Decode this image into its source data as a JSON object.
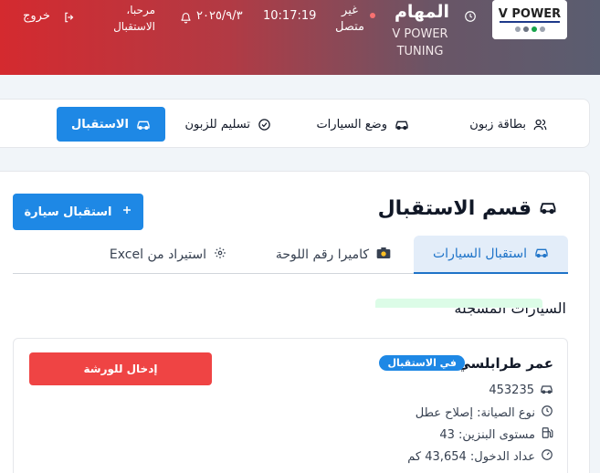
{
  "header": {
    "logo_text": "V POWER",
    "title": "المهام",
    "company": "V POWER TUNING",
    "connection_status": "غير متصل",
    "time": "10:17:19",
    "date": "٢٠٢٥/٩/٣",
    "welcome": "مرحبا، الاستقبال",
    "logout": "خروج"
  },
  "nav": {
    "items": [
      {
        "label": "بطاقة زبون",
        "icon": "users-icon"
      },
      {
        "label": "وضع السيارات",
        "icon": "car-icon"
      },
      {
        "label": "تسليم للزبون",
        "icon": "check-circle-icon"
      },
      {
        "label": "الاستقبال",
        "icon": "car-icon",
        "active": true
      }
    ]
  },
  "reception": {
    "title": "قسم الاستقبال",
    "add_button": "استقبال سيارة",
    "tabs": [
      {
        "label": "استقبال السيارات",
        "icon": "car-icon",
        "active": true
      },
      {
        "label": "كاميرا رقم اللوحة",
        "icon": "camera-icon"
      },
      {
        "label": "استيراد من Excel",
        "icon": "gear-icon"
      }
    ],
    "registered_title": "السيارات المسجلة"
  },
  "car": {
    "owner": "عمر طرابلسي",
    "status_badge": "في الاستقبال",
    "plate": "453235",
    "maintenance": "نوع الصيانة: إصلاح عطل",
    "fuel": "مستوى البنزين: 43",
    "odometer": "عداد الدخول: 43,654 كم",
    "enter_button": "إدخال للورشة"
  },
  "colors": {
    "header_start": "#d42a2f",
    "header_end": "#5a5d70",
    "primary": "#1e88e5",
    "danger": "#ef4444"
  }
}
